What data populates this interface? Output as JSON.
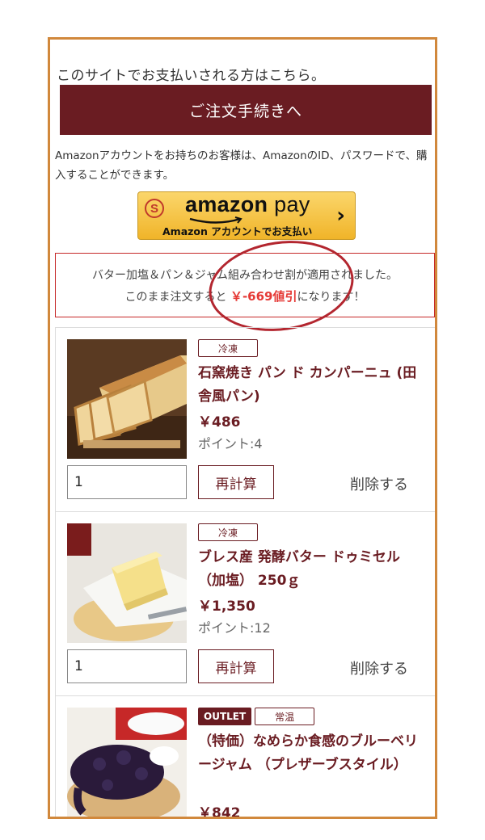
{
  "intro_text": "このサイトでお支払いされる方はこちら。",
  "checkout_button": "ご注文手続きへ",
  "amazon_note": "Amazonアカウントをお持ちのお客様は、AmazonのID、パスワードで、購入することができます。",
  "amazon_pay": {
    "brand": "amazon",
    "brand_suffix": "pay",
    "sub": "Amazon アカウントでお支払い",
    "coin": "S",
    "chevron": "›",
    "color": "#f5c242"
  },
  "promo": {
    "line1": "バター加塩＆パン＆ジャム組み合わせ割が適用されました。",
    "line2_pre": "このまま注文すると ",
    "amount": "￥-669値引",
    "line2_post": "になります！"
  },
  "items": [
    {
      "tag": "冷凍",
      "name": "石窯焼き パン ド カンパーニュ (田舎風パン)",
      "price": "￥486",
      "point": "ポイント:4",
      "qty": "1",
      "recalc": "再計算",
      "delete": "削除する"
    },
    {
      "tag": "冷凍",
      "name": "ブレス産 発酵バター ドゥミセル （加塩） 250ｇ",
      "price": "￥1,350",
      "point": "ポイント:12",
      "qty": "1",
      "recalc": "再計算",
      "delete": "削除する"
    },
    {
      "outlet_tag": "OUTLET",
      "tag": "常温",
      "name": "（特価）なめらか食感のブルーベリージャム （プレザーブスタイル）",
      "price": "￥842"
    }
  ],
  "colors": {
    "brand": "#6a1c22",
    "frame": "#d1883c",
    "highlight": "#e53935"
  }
}
